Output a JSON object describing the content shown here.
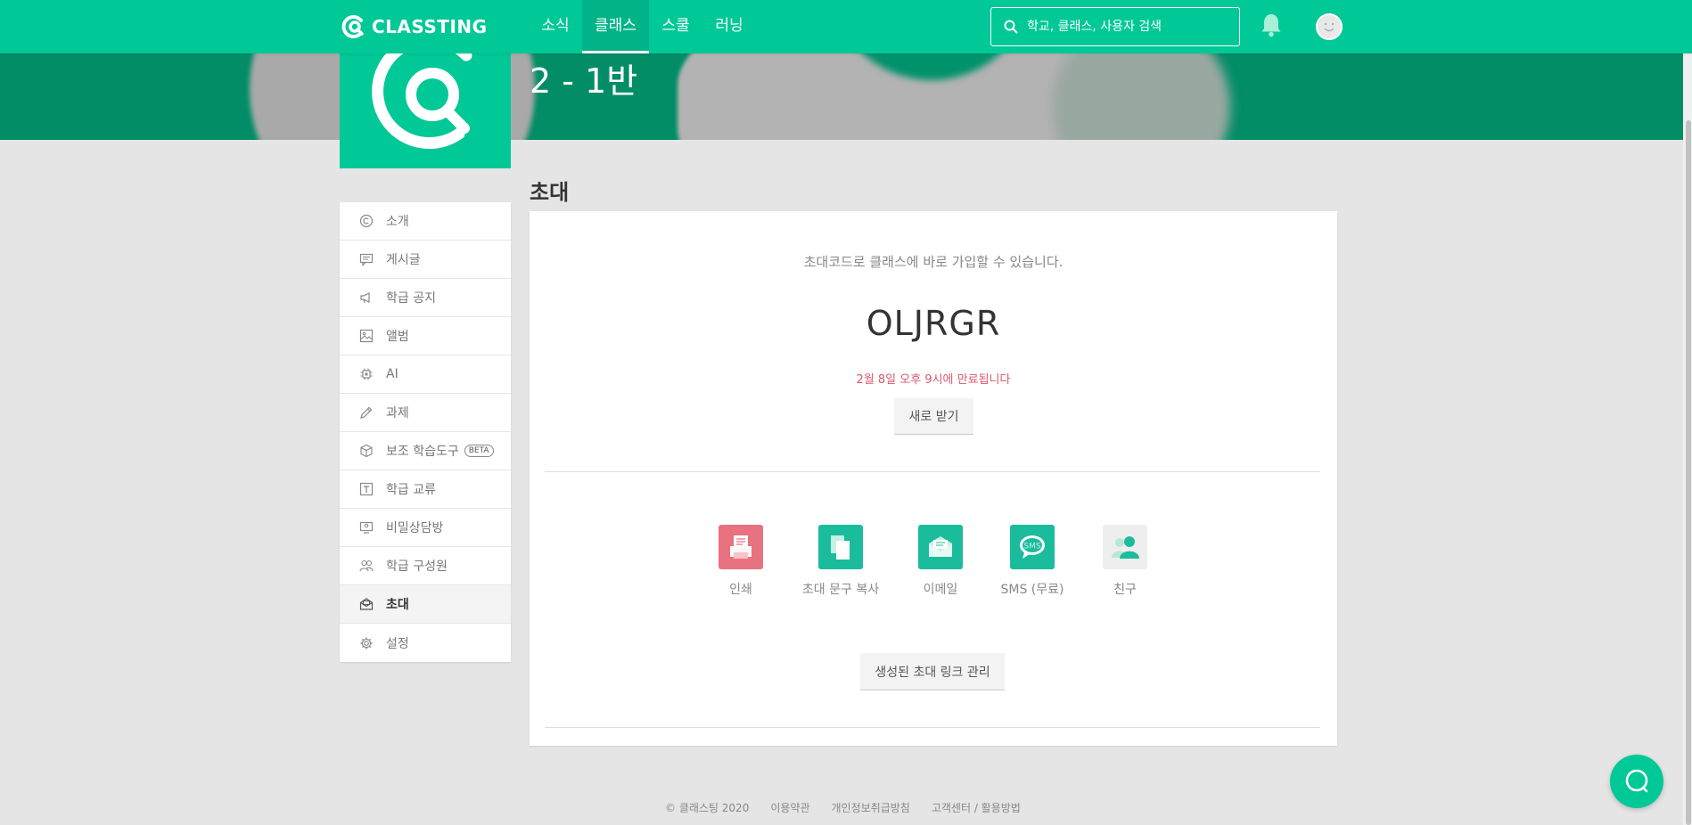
{
  "nav": {
    "logo_text": "CLASSTING",
    "tabs": [
      {
        "label": "소식"
      },
      {
        "label": "클래스"
      },
      {
        "label": "스쿨"
      },
      {
        "label": "러닝"
      }
    ],
    "search_placeholder": "학교, 클래스, 사용자 검색"
  },
  "class_title": "2 - 1반",
  "sidebar": {
    "items": [
      {
        "label": "소개",
        "icon": "copyright-icon"
      },
      {
        "label": "게시글",
        "icon": "post-icon"
      },
      {
        "label": "학급 공지",
        "icon": "megaphone-icon"
      },
      {
        "label": "앨범",
        "icon": "image-icon"
      },
      {
        "label": "AI",
        "icon": "chip-icon"
      },
      {
        "label": "과제",
        "icon": "pencil-icon"
      },
      {
        "label": "보조 학습도구",
        "icon": "cube-icon",
        "badge": "BETA"
      },
      {
        "label": "학급 교류",
        "icon": "text-box-icon"
      },
      {
        "label": "비밀상담방",
        "icon": "secret-icon"
      },
      {
        "label": "학급 구성원",
        "icon": "members-icon"
      },
      {
        "label": "초대",
        "icon": "invite-icon"
      },
      {
        "label": "설정",
        "icon": "gear-icon"
      }
    ]
  },
  "main": {
    "title": "초대",
    "description": "초대코드로 클래스에 바로 가입할 수 있습니다.",
    "invite_code": "OLJRGR",
    "expire_text": "2월 8일 오후 9시에 만료됩니다",
    "renew_button": "새로 받기",
    "share_options": [
      {
        "label": "인쇄",
        "icon": "print-icon",
        "color": "#e8727f"
      },
      {
        "label": "초대 문구 복사",
        "icon": "copy-icon",
        "color": "#1abc9c"
      },
      {
        "label": "이메일",
        "icon": "email-icon",
        "color": "#1abc9c"
      },
      {
        "label": "SMS (무료)",
        "icon": "sms-icon",
        "color": "#1abc9c"
      },
      {
        "label": "친구",
        "icon": "friends-icon",
        "color": "#eeeeee"
      }
    ],
    "manage_button": "생성된 초대 링크 관리"
  },
  "footer": {
    "links": [
      "© 클래스팅 2020",
      "이용약관",
      "개인정보취급방침",
      "고객센터 / 활용방법"
    ]
  },
  "colors": {
    "brand": "#00c896",
    "banner": "#028d66",
    "expire": "#d8586c"
  }
}
